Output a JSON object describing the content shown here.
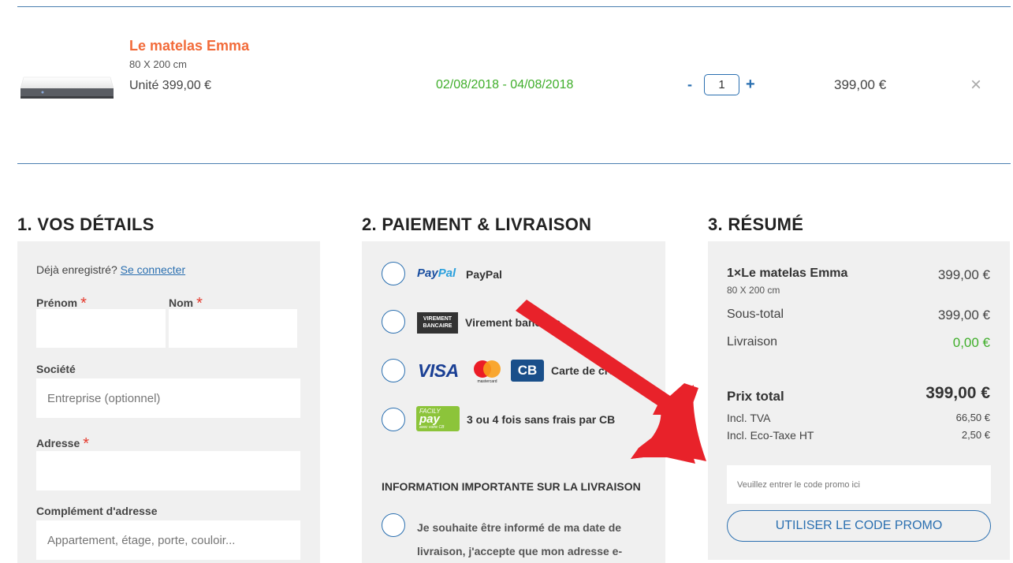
{
  "product": {
    "name": "Le matelas Emma",
    "size": "80 X 200 cm",
    "unit_price": "Unité 399,00 €",
    "dates": "02/08/2018 - 04/08/2018",
    "qty_minus": "-",
    "qty_value": "1",
    "qty_plus": "+",
    "price": "399,00 €",
    "remove": "×"
  },
  "sections": {
    "details": "1. VOS DÉTAILS",
    "payment": "2. PAIEMENT & LIVRAISON",
    "summary": "3. RÉSUMÉ"
  },
  "details": {
    "already_registered": "Déjà enregistré?",
    "login_link": "Se connecter",
    "first_name_label": "Prénom",
    "last_name_label": "Nom",
    "required_mark": "*",
    "company_label": "Société",
    "company_placeholder": "Entreprise (optionnel)",
    "address_label": "Adresse",
    "address2_label": "Complément d'adresse",
    "address2_placeholder": "Appartement, étage, porte, couloir..."
  },
  "payment": {
    "paypal_logo_a": "Pay",
    "paypal_logo_b": "Pal",
    "paypal_label": "PayPal",
    "virement_logo": "VIREMENT BANCAIRE",
    "virement_label": "Virement bancaire",
    "visa_logo": "VISA",
    "mastercard_logo": "mastercard",
    "cb_logo": "CB",
    "card_label": "Carte de crédit",
    "facily_logo_small": "FACILY",
    "facily_logo_big": "pay",
    "facily_logo_sub": "avec votre CB",
    "facily_label": "3 ou 4 fois sans frais par CB",
    "info_title": "INFORMATION IMPORTANTE SUR LA LIVRAISON",
    "info_text": "Je souhaite être informé de ma date de livraison, j'accepte que mon adresse e-"
  },
  "summary": {
    "item_name": "1×Le matelas Emma",
    "item_size": "80 X 200 cm",
    "item_price": "399,00 €",
    "subtotal_label": "Sous-total",
    "subtotal_value": "399,00 €",
    "shipping_label": "Livraison",
    "shipping_value": "0,00 €",
    "total_label": "Prix total",
    "total_value": "399,00 €",
    "vat_label": "Incl. TVA",
    "vat_value": "66,50 €",
    "ecotax_label": "Incl. Eco-Taxe HT",
    "ecotax_value": "2,50 €",
    "promo_placeholder": "Veuillez entrer le code promo ici",
    "promo_button": "UTILISER LE CODE PROMO"
  },
  "colors": {
    "accent_blue": "#2a6fb0",
    "product_orange": "#f26b3a",
    "green": "#3fae2a",
    "annotation_red": "#e8222a",
    "panel_bg": "#f0f0f0"
  },
  "icons": {
    "remove": "close-icon",
    "annotation": "red-arrow-annotation"
  }
}
